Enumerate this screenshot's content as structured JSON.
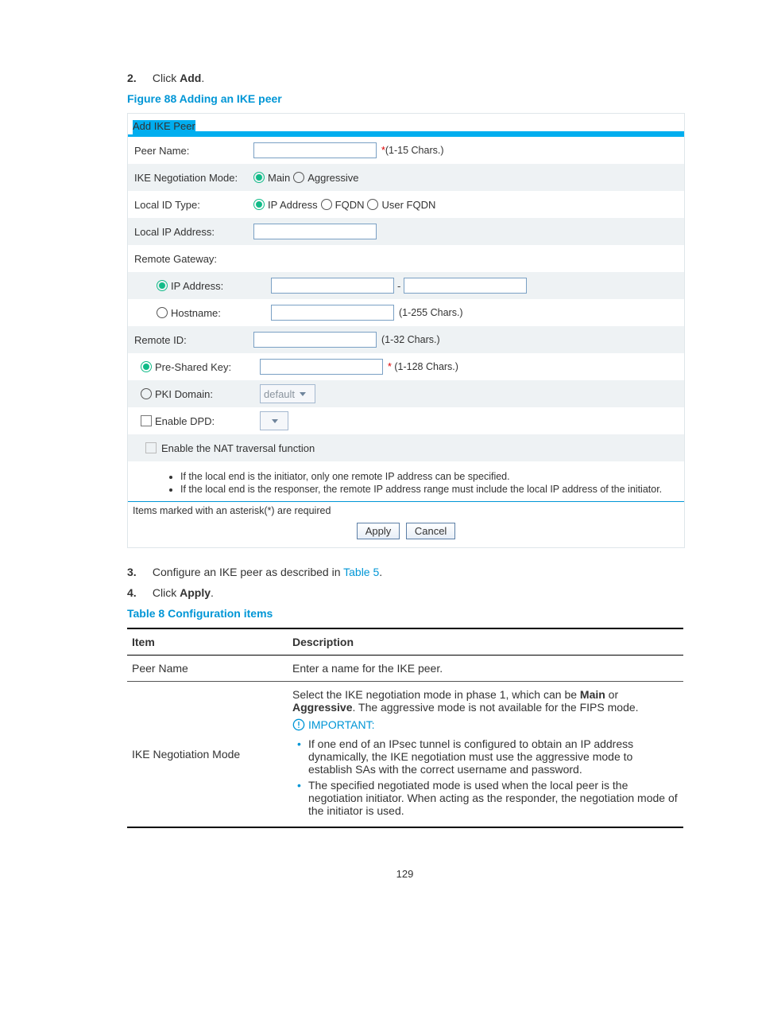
{
  "steps": {
    "s2_num": "2.",
    "s2_a": "Click ",
    "s2_b": "Add",
    "s2_c": ".",
    "s3_num": "3.",
    "s3_a": "Configure an IKE peer as described in ",
    "s3_link": "Table 5",
    "s3_c": ".",
    "s4_num": "4.",
    "s4_a": "Click ",
    "s4_b": "Apply",
    "s4_c": "."
  },
  "figure_caption": "Figure 88 Adding an IKE peer",
  "table_caption": "Table 8 Configuration items",
  "form": {
    "tab": "Add IKE Peer",
    "peer_name_label": "Peer Name:",
    "peer_name_hint": "(1-15 Chars.)",
    "neg_mode_label": "IKE Negotiation Mode:",
    "neg_main": "Main",
    "neg_aggr": "Aggressive",
    "local_id_label": "Local ID Type:",
    "lid_ip": "IP Address",
    "lid_fqdn": "FQDN",
    "lid_user": "User FQDN",
    "local_ip_label": "Local IP Address:",
    "remote_gw_label": "Remote Gateway:",
    "rg_ip": "IP Address:",
    "rg_dash": "-",
    "rg_host": "Hostname:",
    "rg_host_hint": "(1-255 Chars.)",
    "remote_id_label": "Remote ID:",
    "remote_id_hint": "(1-32 Chars.)",
    "psk_label": "Pre-Shared Key:",
    "psk_hint": "(1-128 Chars.)",
    "pki_label": "PKI Domain:",
    "pki_sel": "default",
    "dpd_label": "Enable DPD:",
    "nat_label": "Enable the NAT traversal function",
    "note1": "If the local end is the initiator, only one remote IP address can be specified.",
    "note2": "If the local end is the responser, the remote IP address range must include the local IP address of the initiator.",
    "req_line": "Items marked with an asterisk(*) are required",
    "apply": "Apply",
    "cancel": "Cancel",
    "star": "*"
  },
  "table": {
    "h_item": "Item",
    "h_desc": "Description",
    "r1_item": "Peer Name",
    "r1_desc": "Enter a name for the IKE peer.",
    "r2_item": "IKE Negotiation Mode",
    "r2_p1a": "Select the IKE negotiation mode in phase 1, which can be ",
    "r2_p1b": "Main",
    "r2_p1c": " or ",
    "r2_p1d": "Aggressive",
    "r2_p1e": ". The aggressive mode is not available for the FIPS mode.",
    "r2_imp": "IMPORTANT:",
    "r2_b1": "If one end of an IPsec tunnel is configured to obtain an IP address dynamically, the IKE negotiation must use the aggressive mode to establish SAs with the correct username and password.",
    "r2_b2": "The specified negotiated mode is used when the local peer is the negotiation initiator. When acting as the responder, the negotiation mode of the initiator is used."
  },
  "page_number": "129"
}
